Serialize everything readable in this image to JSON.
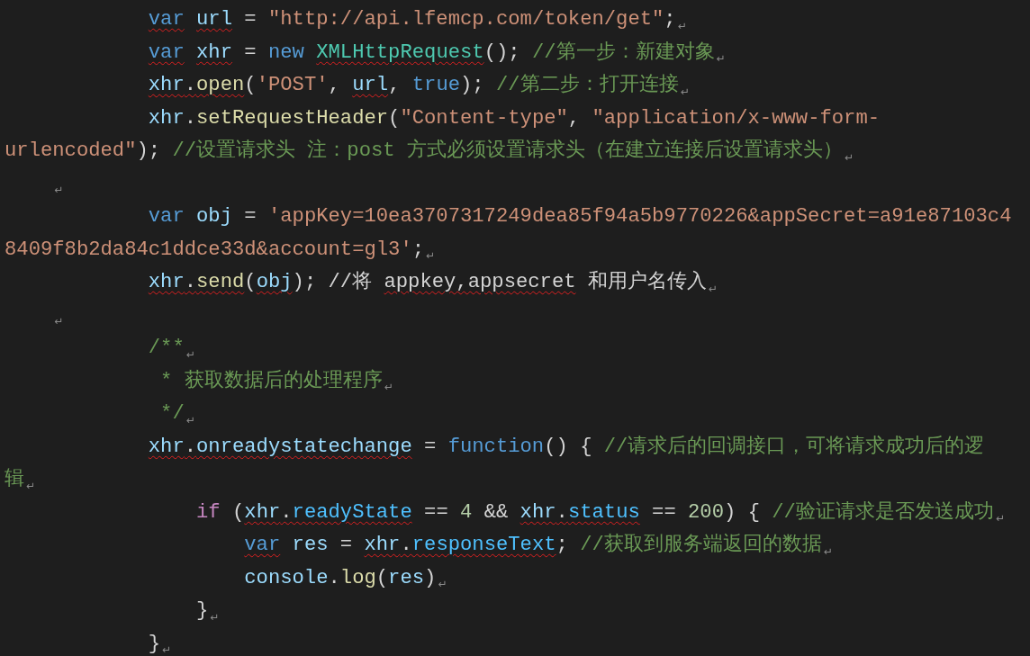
{
  "lines": [
    {
      "kind": "statement",
      "tokens": [
        {
          "text": "var",
          "kind": "keyword",
          "misspelled": true
        },
        {
          "text": "url",
          "kind": "variable",
          "misspelled": true,
          "gap": true
        },
        {
          "text": " = ",
          "kind": "plain"
        },
        {
          "text": "\"http://api.lfemcp.com/token/get\"",
          "kind": "string"
        },
        {
          "text": ";",
          "kind": "plain"
        }
      ],
      "mark": "↵"
    },
    {
      "kind": "statement",
      "tokens": [
        {
          "text": "var",
          "kind": "keyword",
          "misspelled": true
        },
        {
          "text": "xhr",
          "kind": "variable",
          "misspelled": true,
          "gap": true
        },
        {
          "text": " = ",
          "kind": "plain"
        },
        {
          "text": "new",
          "kind": "keyword"
        },
        {
          "text": "XMLHttpRequest",
          "kind": "class",
          "misspelled": true,
          "gap": true
        },
        {
          "text": "(); ",
          "kind": "plain"
        },
        {
          "text": "//第一步：新建对象",
          "kind": "comment"
        }
      ],
      "mark": "↵"
    },
    {
      "kind": "statement",
      "tokens": [
        {
          "text": "xhr",
          "kind": "variable",
          "misspelled": true
        },
        {
          "text": ".",
          "kind": "plain",
          "misspelled": true
        },
        {
          "text": "open",
          "kind": "function",
          "misspelled": true
        },
        {
          "text": "(",
          "kind": "plain"
        },
        {
          "text": "'POST'",
          "kind": "string"
        },
        {
          "text": ", ",
          "kind": "plain"
        },
        {
          "text": "url",
          "kind": "variable",
          "misspelled": true
        },
        {
          "text": ", ",
          "kind": "plain"
        },
        {
          "text": "true",
          "kind": "keyword"
        },
        {
          "text": "); ",
          "kind": "plain"
        },
        {
          "text": "//第二步：打开连接",
          "kind": "comment"
        }
      ],
      "mark": "↵"
    },
    {
      "kind": "statement",
      "tokens": [
        {
          "text": "xhr",
          "kind": "variable"
        },
        {
          "text": ".",
          "kind": "plain"
        },
        {
          "text": "setRequestHeader",
          "kind": "function"
        },
        {
          "text": "(",
          "kind": "plain"
        },
        {
          "text": "\"Content-type\"",
          "kind": "string"
        },
        {
          "text": ", ",
          "kind": "plain"
        },
        {
          "text": "\"application/x-www-form-",
          "kind": "string"
        }
      ]
    },
    {
      "tokens": [
        {
          "text": "urlencoded\"",
          "kind": "string"
        },
        {
          "text": "); ",
          "kind": "plain"
        },
        {
          "text": "//设置请求头 注：post 方式必须设置请求头（在建立连接后设置请求头）",
          "kind": "comment"
        }
      ],
      "mark": "↵"
    },
    {
      "kind": "margin",
      "mark": "↵"
    },
    {
      "kind": "statement",
      "tokens": [
        {
          "text": "var",
          "kind": "keyword"
        },
        {
          "text": "obj",
          "kind": "variable",
          "gap": true
        },
        {
          "text": " = ",
          "kind": "plain"
        },
        {
          "text": "'appKey=10ea3707317249dea85f94a5b9770226&appSecret=a91e87103c4",
          "kind": "string"
        }
      ]
    },
    {
      "tokens": [
        {
          "text": "8409f8b2da84c1ddce33d&account=gl3'",
          "kind": "string"
        },
        {
          "text": ";",
          "kind": "plain"
        }
      ],
      "mark": "↵"
    },
    {
      "kind": "statement",
      "tokens": [
        {
          "text": "xhr",
          "kind": "variable",
          "misspelled": true
        },
        {
          "text": ".",
          "kind": "plain",
          "misspelled": true
        },
        {
          "text": "send",
          "kind": "function",
          "misspelled": true
        },
        {
          "text": "(",
          "kind": "plain"
        },
        {
          "text": "obj",
          "kind": "variable",
          "misspelled": true
        },
        {
          "text": "); //将 ",
          "kind": "plain"
        },
        {
          "text": "appkey,appsecret",
          "kind": "plain",
          "misspelled": true
        },
        {
          "text": " 和用户名传入",
          "kind": "plain"
        }
      ],
      "mark": "↵"
    },
    {
      "kind": "margin",
      "mark": "↵"
    },
    {
      "kind": "statement",
      "tokens": [
        {
          "text": "/**",
          "kind": "comment"
        }
      ],
      "mark": "↵"
    },
    {
      "kind": "doc_comment",
      "tokens": [
        {
          "text": "* 获取数据后的处理程序",
          "kind": "comment"
        }
      ],
      "mark": "↵"
    },
    {
      "kind": "doc_comment",
      "tokens": [
        {
          "text": "*/",
          "kind": "comment"
        }
      ],
      "mark": "↵"
    },
    {
      "kind": "statement",
      "tokens": [
        {
          "text": "xhr",
          "kind": "variable",
          "misspelled": true
        },
        {
          "text": ".",
          "kind": "plain",
          "misspelled": true
        },
        {
          "text": "onreadystatechange",
          "kind": "variable",
          "misspelled": true
        },
        {
          "text": " = ",
          "kind": "plain"
        },
        {
          "text": "function",
          "kind": "keyword"
        },
        {
          "text": "() { ",
          "kind": "plain"
        },
        {
          "text": "//请求后的回调接口，可将请求成功后的逻",
          "kind": "comment"
        }
      ]
    },
    {
      "tokens": [
        {
          "text": "辑",
          "kind": "comment"
        }
      ],
      "mark": "↵"
    },
    {
      "kind": "nested",
      "tokens": [
        {
          "text": "if",
          "kind": "control"
        },
        {
          "text": " (",
          "kind": "plain"
        },
        {
          "text": "xhr",
          "kind": "variable",
          "misspelled": true
        },
        {
          "text": ".",
          "kind": "plain",
          "misspelled": true
        },
        {
          "text": "readyState",
          "kind": "property",
          "misspelled": true
        },
        {
          "text": " == ",
          "kind": "plain"
        },
        {
          "text": "4",
          "kind": "number"
        },
        {
          "text": " && ",
          "kind": "plain"
        },
        {
          "text": "xhr",
          "kind": "variable",
          "misspelled": true
        },
        {
          "text": ".",
          "kind": "plain",
          "misspelled": true
        },
        {
          "text": "status",
          "kind": "property",
          "misspelled": true
        },
        {
          "text": " == ",
          "kind": "plain"
        },
        {
          "text": "200",
          "kind": "number"
        },
        {
          "text": ") { ",
          "kind": "plain"
        },
        {
          "text": "//验证请求是否发送成功",
          "kind": "comment"
        }
      ],
      "mark": "↵"
    },
    {
      "kind": "deep",
      "tokens": [
        {
          "text": "var",
          "kind": "keyword",
          "misspelled": true
        },
        {
          "text": "res",
          "kind": "variable",
          "gap": true
        },
        {
          "text": " = ",
          "kind": "plain"
        },
        {
          "text": "xhr",
          "kind": "variable",
          "misspelled": true
        },
        {
          "text": ".",
          "kind": "plain",
          "misspelled": true
        },
        {
          "text": "responseText",
          "kind": "property",
          "misspelled": true
        },
        {
          "text": "; ",
          "kind": "plain"
        },
        {
          "text": "//获取到服务端返回的数据",
          "kind": "comment"
        }
      ],
      "mark": "↵"
    },
    {
      "kind": "deep",
      "tokens": [
        {
          "text": "console",
          "kind": "variable"
        },
        {
          "text": ".",
          "kind": "plain"
        },
        {
          "text": "log",
          "kind": "function"
        },
        {
          "text": "(",
          "kind": "plain"
        },
        {
          "text": "res",
          "kind": "variable"
        },
        {
          "text": ")",
          "kind": "plain"
        }
      ],
      "mark": "↵"
    },
    {
      "kind": "nested",
      "tokens": [
        {
          "text": "}",
          "kind": "plain"
        }
      ],
      "mark": "↵"
    },
    {
      "kind": "statement",
      "tokens": [
        {
          "text": "}",
          "kind": "plain"
        }
      ],
      "mark": "↵"
    }
  ]
}
